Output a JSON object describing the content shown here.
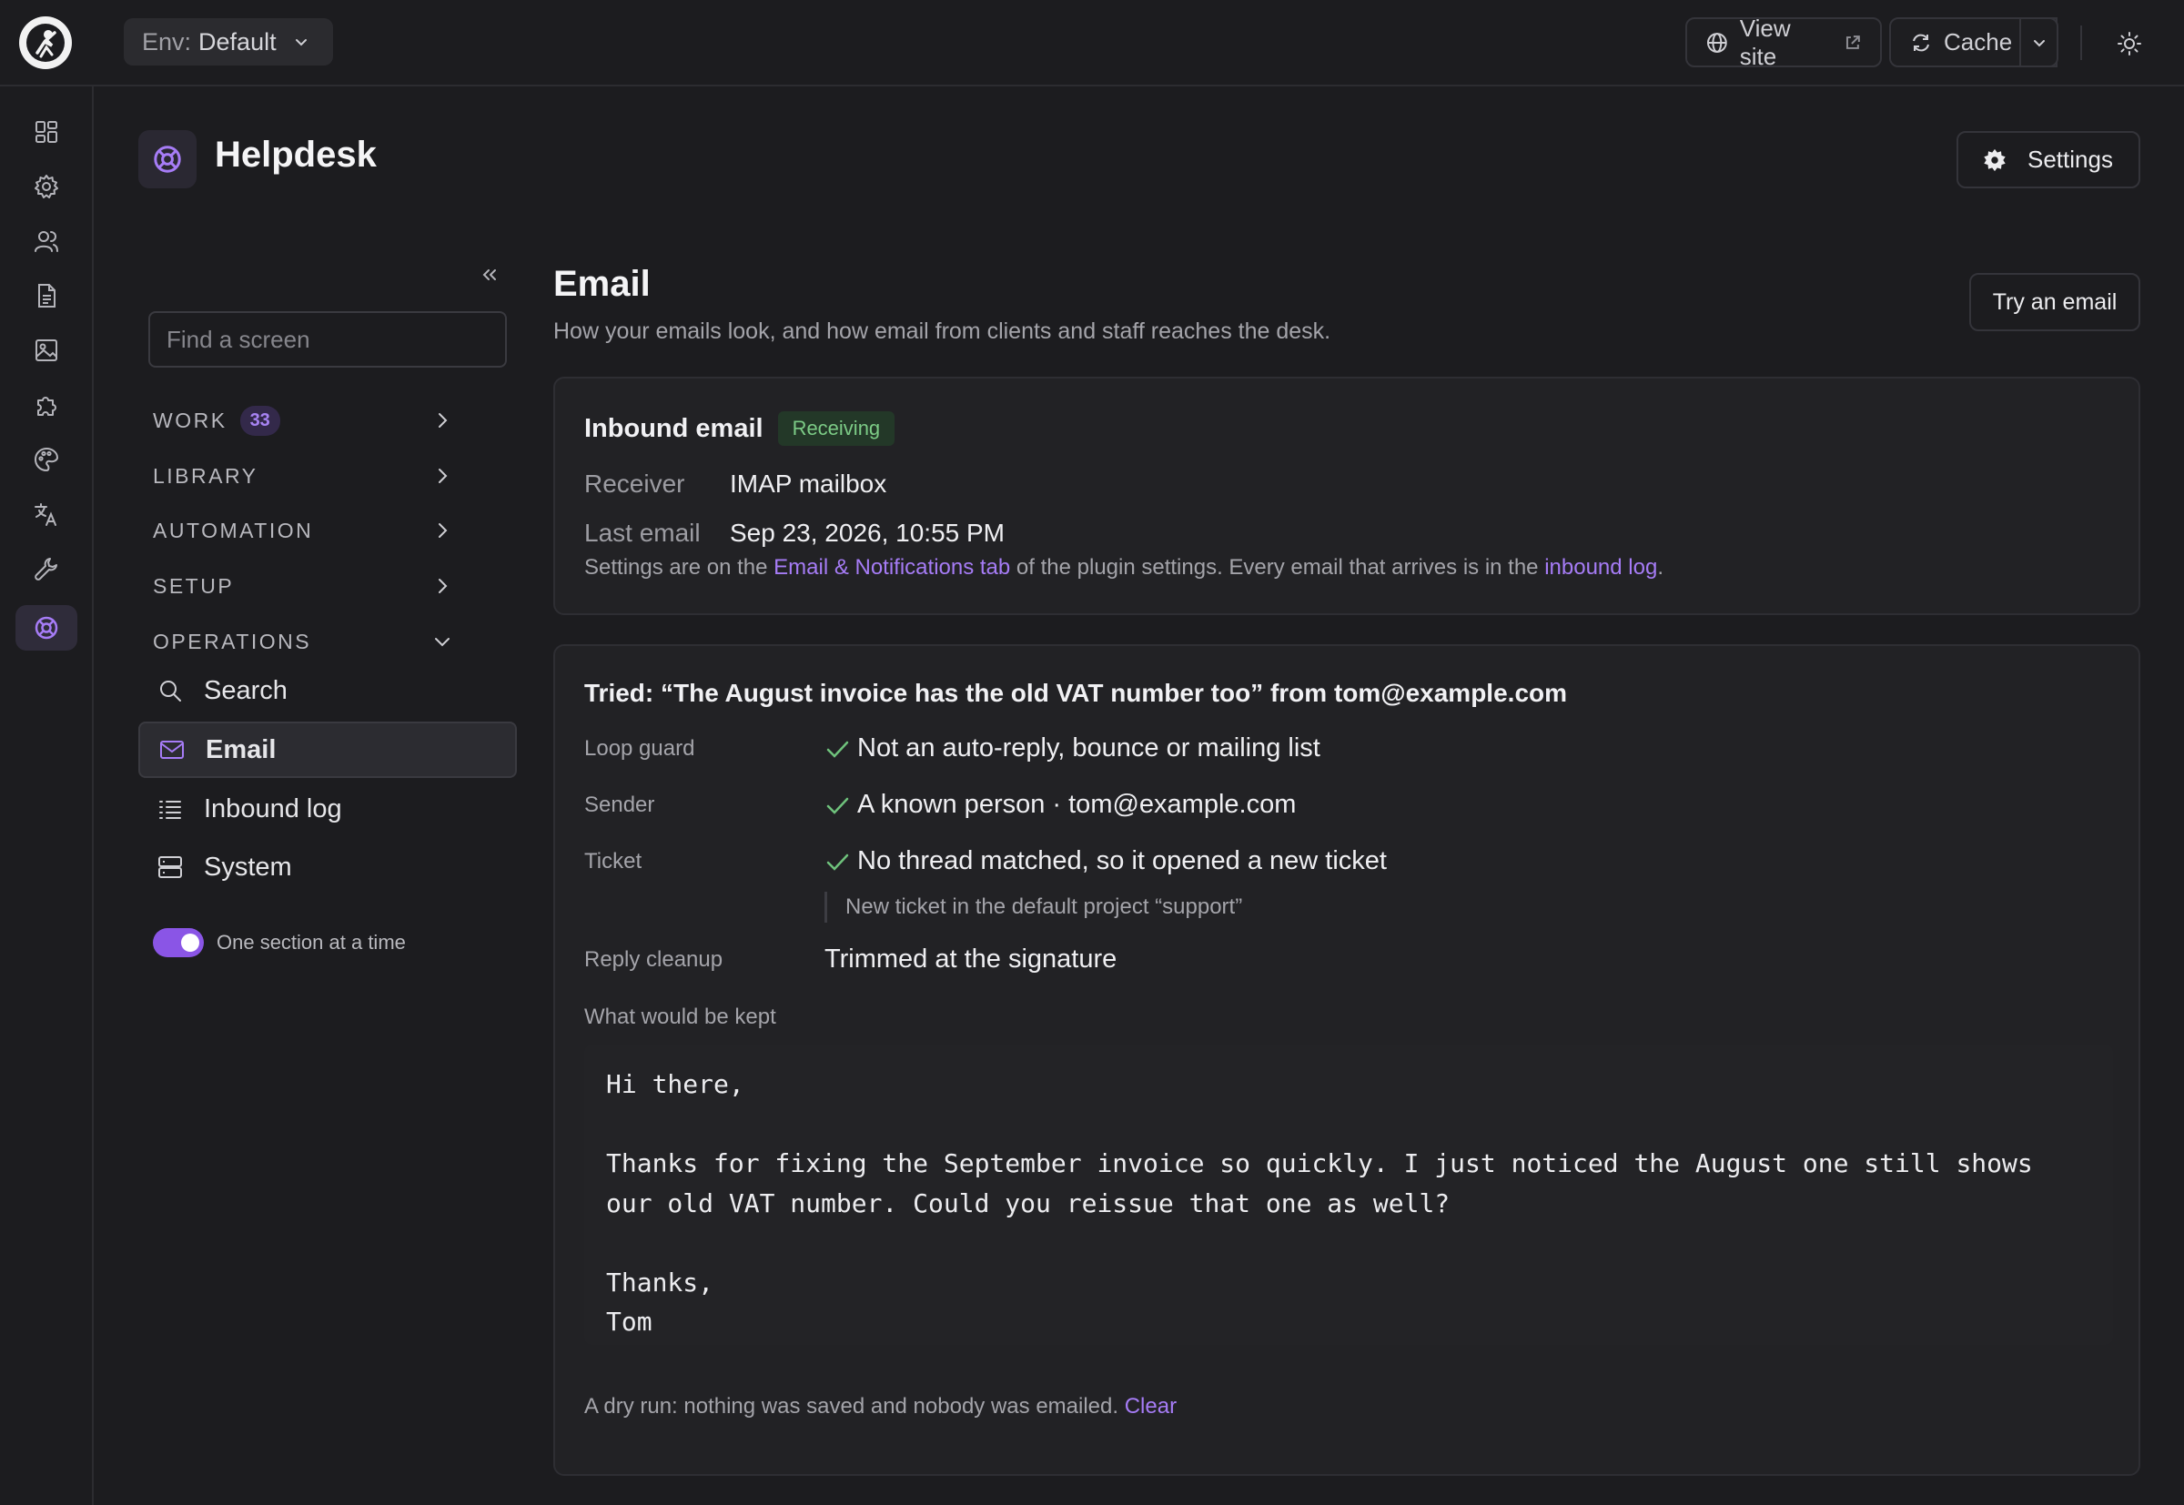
{
  "topbar": {
    "env_label": "Env:",
    "env_value": "Default",
    "view_site_label": "View site",
    "cache_label": "Cache"
  },
  "rail": {
    "items": [
      {
        "icon": "dashboard-icon"
      },
      {
        "icon": "gear-icon"
      },
      {
        "icon": "users-icon"
      },
      {
        "icon": "document-icon"
      },
      {
        "icon": "image-icon"
      },
      {
        "icon": "puzzle-icon"
      },
      {
        "icon": "palette-icon"
      },
      {
        "icon": "translate-icon"
      },
      {
        "icon": "wrench-icon"
      },
      {
        "icon": "lifebuoy-icon",
        "active": true
      }
    ]
  },
  "page": {
    "title": "Helpdesk",
    "settings_label": "Settings"
  },
  "nav": {
    "search_placeholder": "Find a screen",
    "sections": [
      {
        "label": "WORK",
        "badge": "33",
        "expanded": false
      },
      {
        "label": "LIBRARY",
        "expanded": false
      },
      {
        "label": "AUTOMATION",
        "expanded": false
      },
      {
        "label": "SETUP",
        "expanded": false
      },
      {
        "label": "OPERATIONS",
        "expanded": true
      }
    ],
    "items": [
      {
        "label": "Search",
        "icon": "search-icon"
      },
      {
        "label": "Email",
        "icon": "mail-icon",
        "active": true
      },
      {
        "label": "Inbound log",
        "icon": "list-icon"
      },
      {
        "label": "System",
        "icon": "server-icon"
      }
    ],
    "toggle_label": "One section at a time",
    "toggle_on": true
  },
  "main": {
    "title": "Email",
    "subtitle": "How your emails look, and how email from clients and staff reaches the desk.",
    "try_button": "Try an email"
  },
  "inbound": {
    "title": "Inbound email",
    "status": "Receiving",
    "receiver_label": "Receiver",
    "receiver_value": "IMAP mailbox",
    "last_label": "Last email",
    "last_value": "Sep 23, 2026, 10:55 PM",
    "note_pre": "Settings are on the ",
    "note_link1": "Email & Notifications tab",
    "note_mid": " of the plugin settings. Every email that arrives is in the ",
    "note_link2": "inbound log",
    "note_post": "."
  },
  "tried": {
    "title": "Tried: “The August invoice has the old VAT number too” from tom@example.com",
    "rows": [
      {
        "label": "Loop guard",
        "value": "Not an auto-reply, bounce or mailing list",
        "check": true
      },
      {
        "label": "Sender",
        "value": "A known person · tom@example.com",
        "check": true
      },
      {
        "label": "Ticket",
        "value": "No thread matched, so it opened a new ticket",
        "check": true
      },
      {
        "label": "Reply cleanup",
        "value": "Trimmed at the signature",
        "check": false
      }
    ],
    "ticket_note": "New ticket in the default project “support”",
    "kept_label": "What would be kept",
    "kept_body": "Hi there,\n\nThanks for fixing the September invoice so quickly. I just noticed the August one still shows\nour old VAT number. Could you reissue that one as well?\n\nThanks,\nTom",
    "dry_run": "A dry run: nothing was saved and nobody was emailed.",
    "clear_label": "Clear"
  },
  "colors": {
    "accent": "#a67cf6",
    "success": "#7ccb86",
    "background": "#1c1c1f",
    "card": "#222225"
  }
}
